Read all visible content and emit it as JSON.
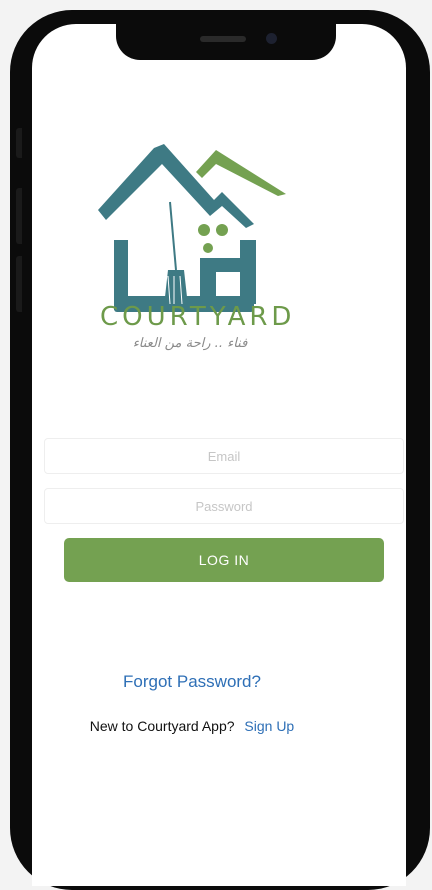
{
  "brand": {
    "name": "COURTYARD",
    "tagline": "فناء .. راحة من العناء",
    "colors": {
      "teal": "#3e7a84",
      "green": "#74a151",
      "dark_green": "#6d9a4a"
    }
  },
  "login_form": {
    "email_placeholder": "Email",
    "password_placeholder": "Password",
    "login_button_label": "LOG IN"
  },
  "links": {
    "forgot_password": "Forgot Password?",
    "signup_prompt": "New to Courtyard App?",
    "signup_label": "Sign Up"
  }
}
